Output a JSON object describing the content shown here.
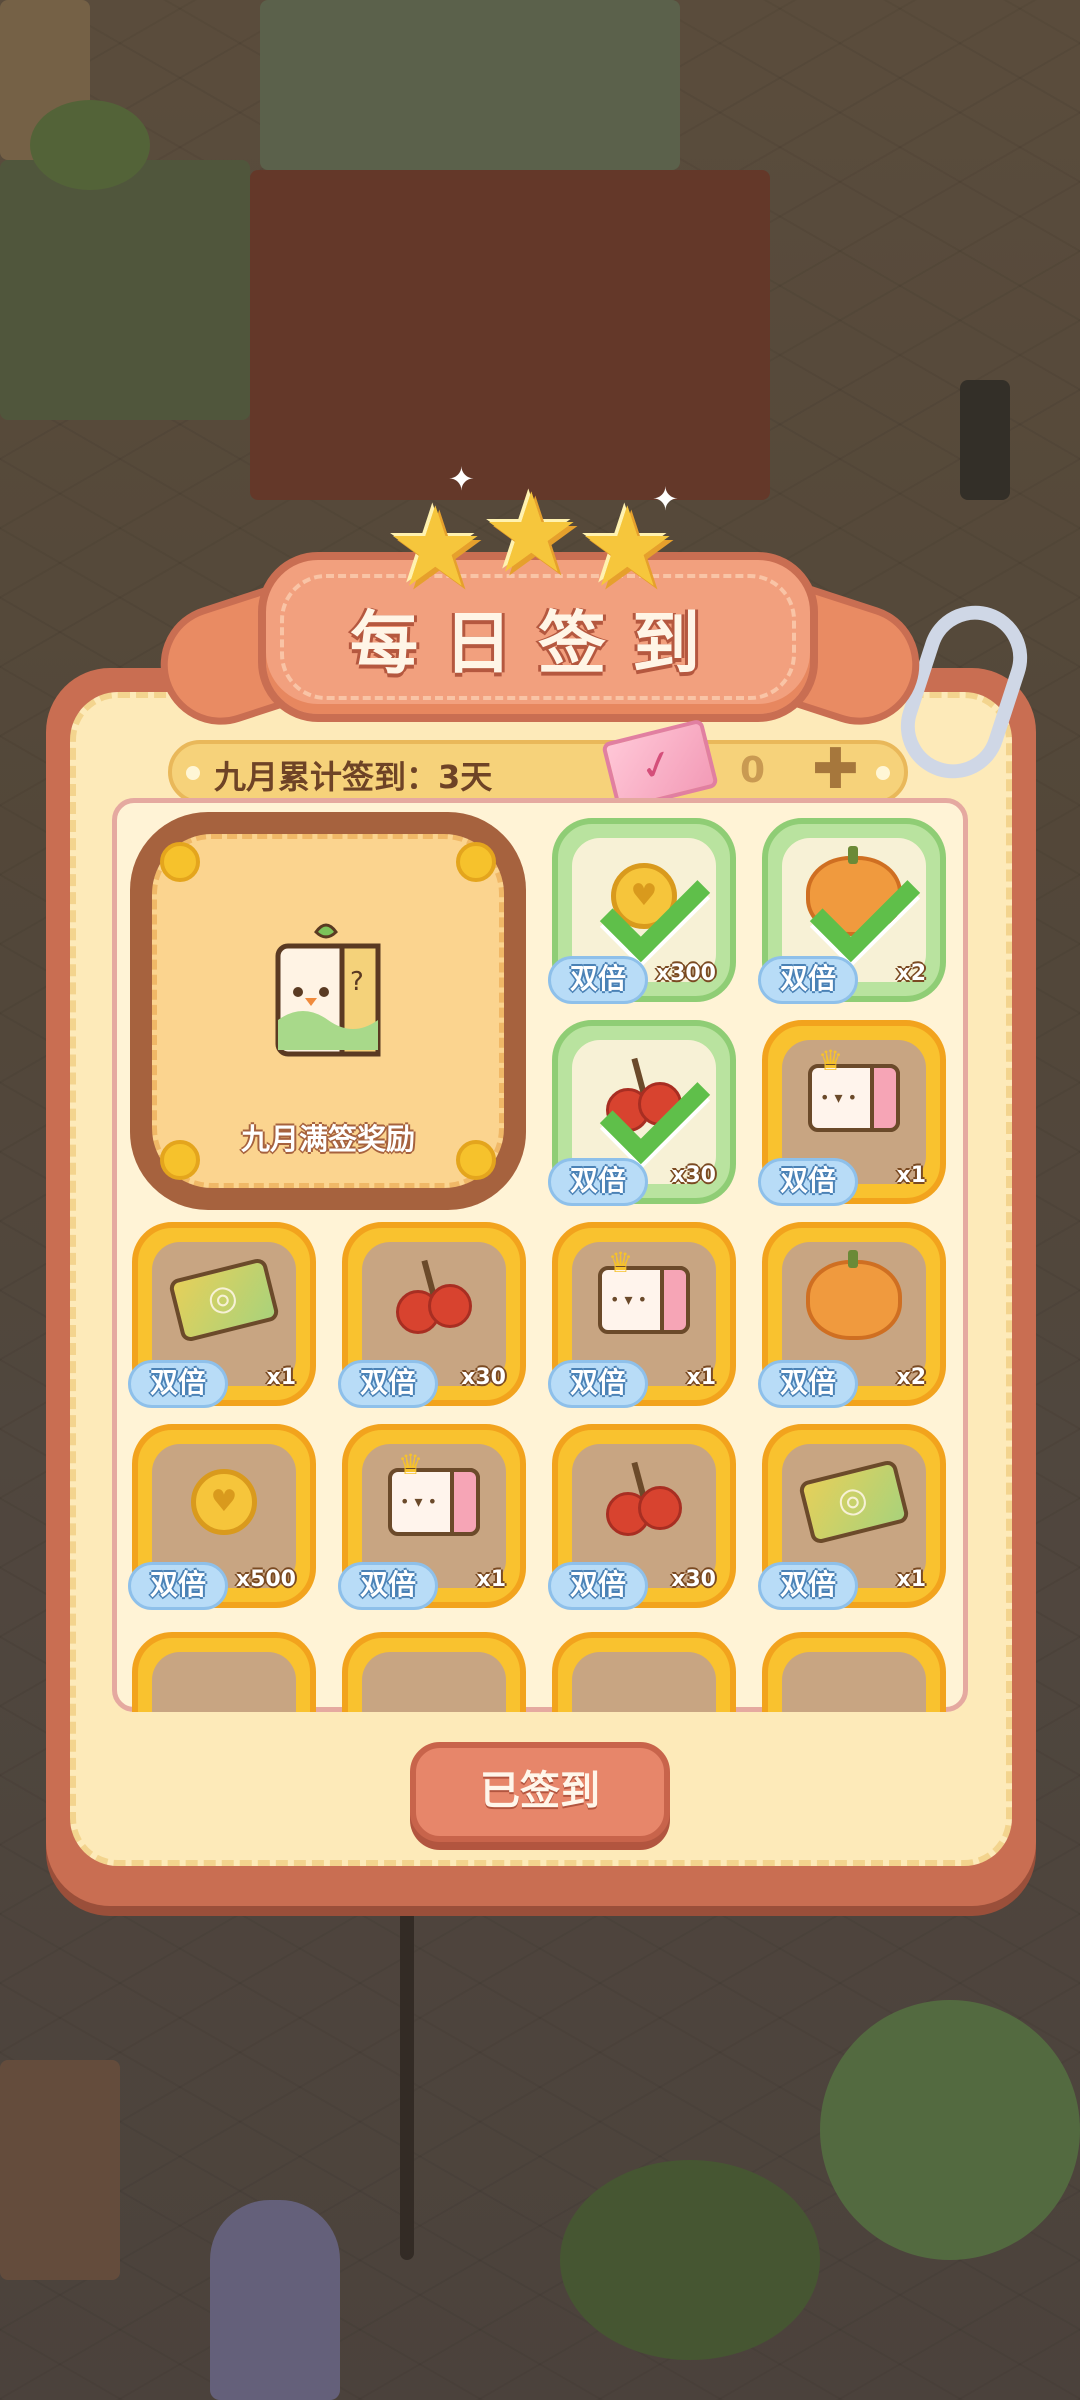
{
  "dialog": {
    "title": "每日签到",
    "cumulative_label": "九月累计签到：3天",
    "ticket_count": "0",
    "grand_reward_label": "九月满签奖励",
    "signed_button": "已签到"
  },
  "double_label": "双倍",
  "rewards": [
    {
      "item": "coin",
      "qty": "x300",
      "claimed": true
    },
    {
      "item": "pumpkin",
      "qty": "x2",
      "claimed": true
    },
    {
      "item": "cherry",
      "qty": "x30",
      "claimed": true
    },
    {
      "item": "crown-package",
      "qty": "x1",
      "claimed": false
    },
    {
      "item": "voucher",
      "qty": "x1",
      "claimed": false
    },
    {
      "item": "cherry",
      "qty": "x30",
      "claimed": false
    },
    {
      "item": "crown-package",
      "qty": "x1",
      "claimed": false
    },
    {
      "item": "pumpkin",
      "qty": "x2",
      "claimed": false
    },
    {
      "item": "coin",
      "qty": "x500",
      "claimed": false
    },
    {
      "item": "crown-package",
      "qty": "x1",
      "claimed": false
    },
    {
      "item": "cherry",
      "qty": "x30",
      "claimed": false
    },
    {
      "item": "voucher",
      "qty": "x1",
      "claimed": false
    }
  ],
  "colors": {
    "dialog_frame": "#c96e52",
    "dialog_fill": "#fdeab9",
    "pending_tile": "#f9c22f",
    "claimed_tile": "#b9e39f",
    "check": "#5fbf4a",
    "button": "#e7866a"
  }
}
